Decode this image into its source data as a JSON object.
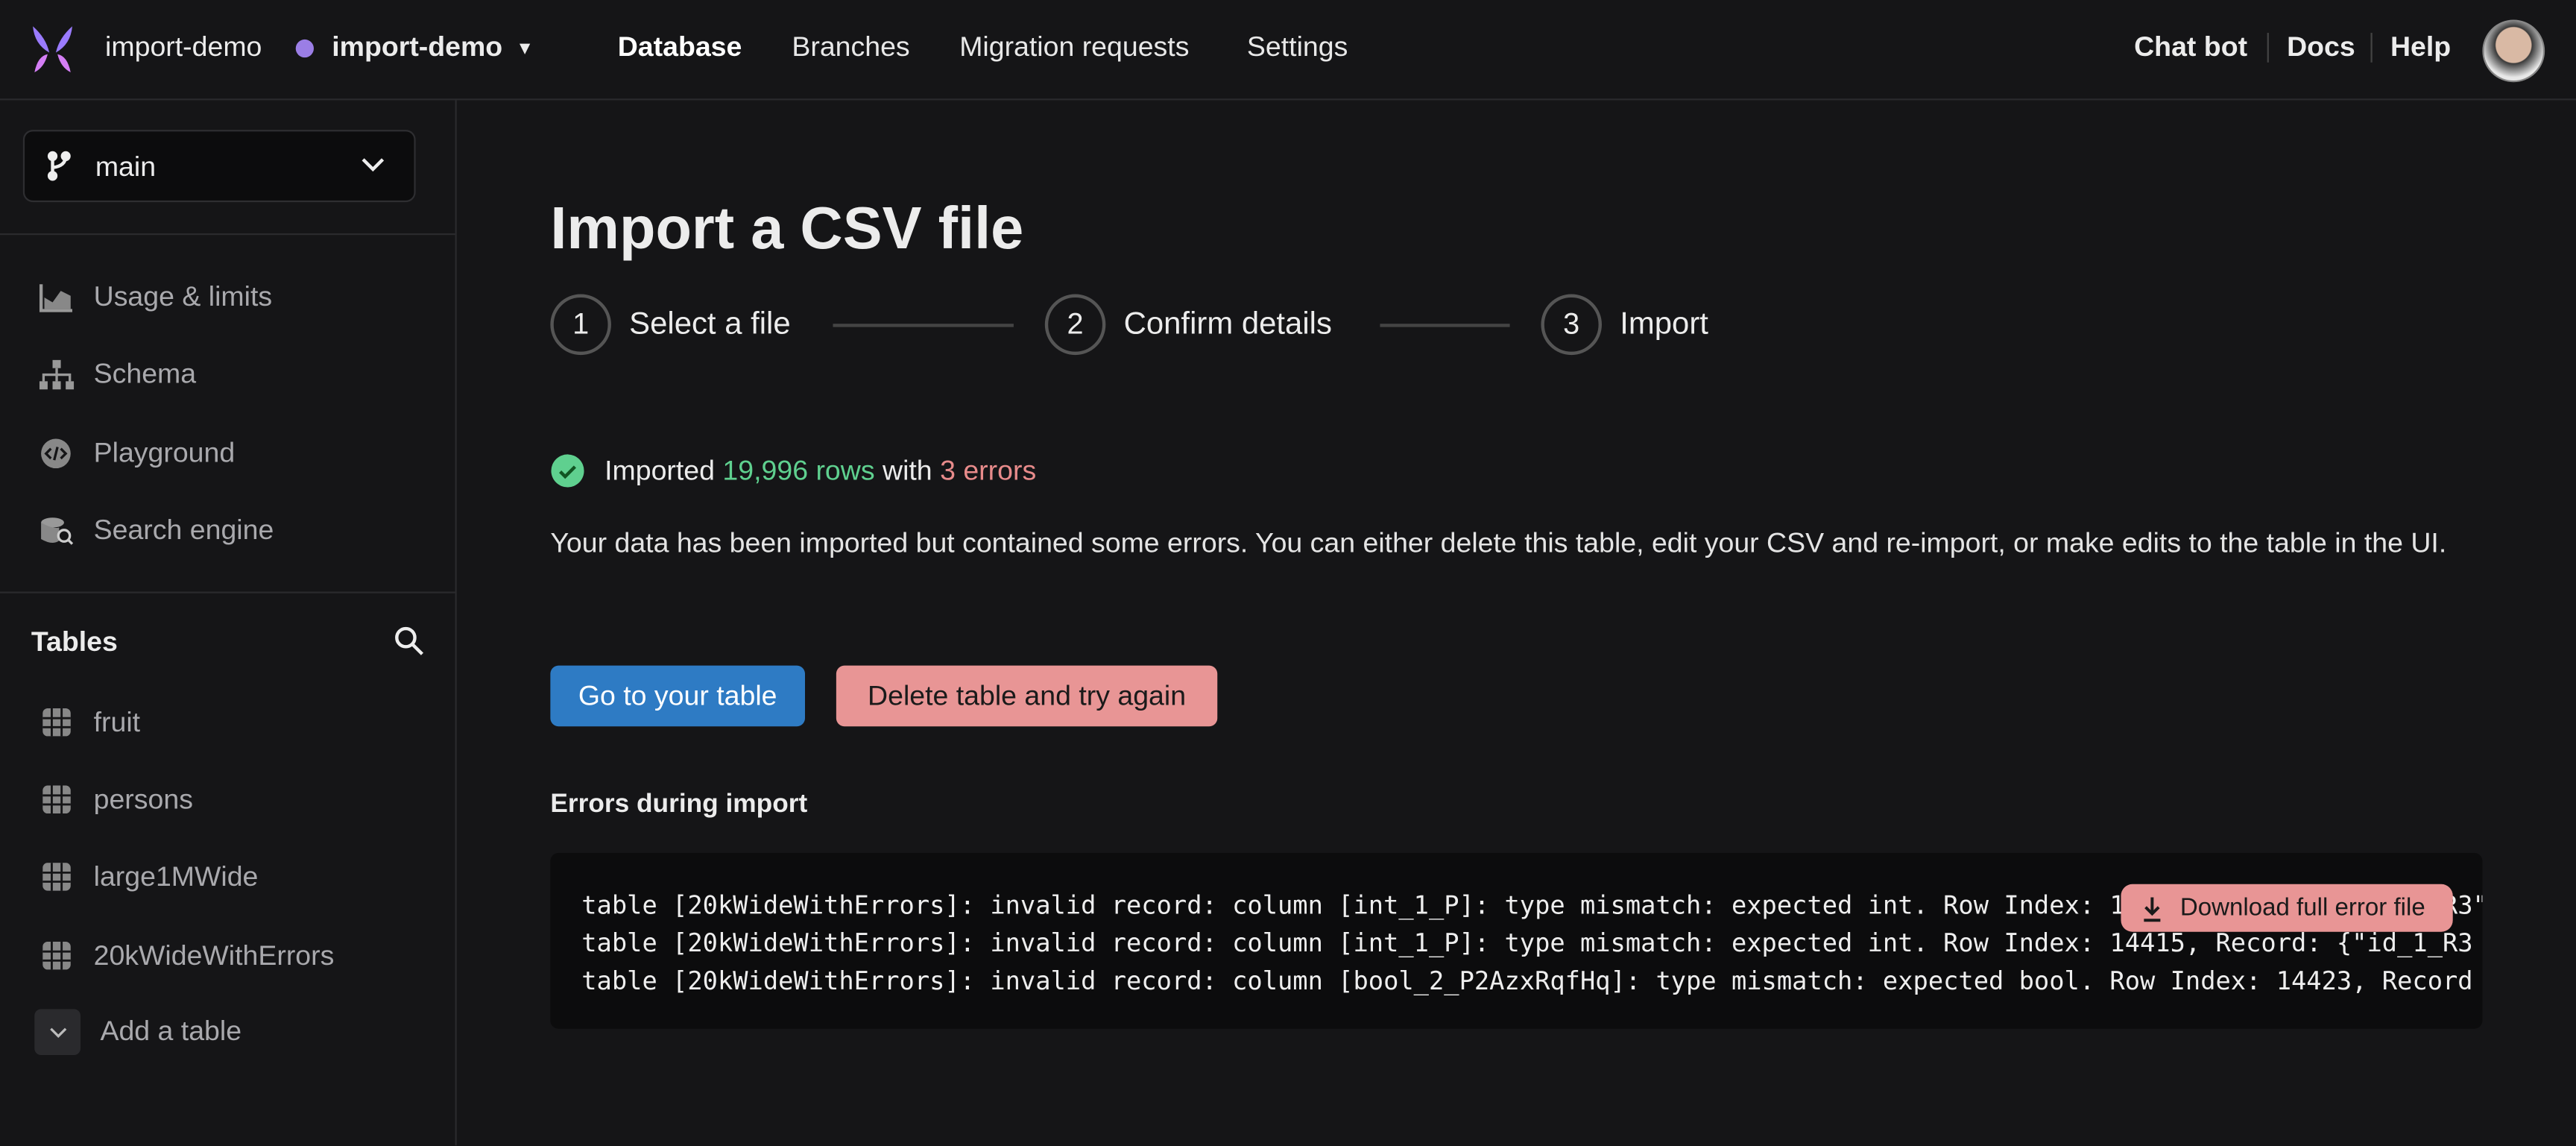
{
  "header": {
    "workspace": "import-demo",
    "database": "import-demo",
    "nav": [
      "Database",
      "Branches",
      "Migration requests",
      "Settings"
    ],
    "active_nav": "Database",
    "right": [
      "Chat bot",
      "Docs",
      "Help"
    ]
  },
  "sidebar": {
    "branch": "main",
    "items": [
      {
        "label": "Usage & limits",
        "icon": "chart-icon"
      },
      {
        "label": "Schema",
        "icon": "schema-icon"
      },
      {
        "label": "Playground",
        "icon": "code-icon"
      },
      {
        "label": "Search engine",
        "icon": "search-engine-icon"
      }
    ],
    "tables_label": "Tables",
    "tables": [
      "fruit",
      "persons",
      "large1MWide",
      "20kWideWithErrors"
    ],
    "add_table": "Add a table"
  },
  "main": {
    "title": "Import a CSV file",
    "steps": [
      {
        "n": "1",
        "label": "Select a file"
      },
      {
        "n": "2",
        "label": "Confirm details"
      },
      {
        "n": "3",
        "label": "Import"
      }
    ],
    "status": {
      "prefix": "Imported",
      "rows": "19,996 rows",
      "mid": "with",
      "errors": "3 errors"
    },
    "description": "Your data has been imported but contained some errors. You can either delete this table, edit your CSV and re-import, or make edits to the table in the UI.",
    "go_button": "Go to your table",
    "delete_button": "Delete table and try again",
    "errors_heading": "Errors during import",
    "error_lines": [
      "table [20kWideWithErrors]: invalid record: column [int_1_P]: type mismatch: expected int. Row Index: 14410, Record: {\"id_1_R3\"",
      "table [20kWideWithErrors]: invalid record: column [int_1_P]: type mismatch: expected int. Row Index: 14415, Record: {\"id_1_R3",
      "table [20kWideWithErrors]: invalid record: column [bool_2_P2AzxRqfHq]: type mismatch: expected bool. Row Index: 14423, Record"
    ],
    "download_button": "Download full error file"
  },
  "colors": {
    "success": "#5fd08f",
    "error": "#e88b8b",
    "primary": "#2e7bc4",
    "danger": "#e89595",
    "accent": "#9b7ee6"
  }
}
